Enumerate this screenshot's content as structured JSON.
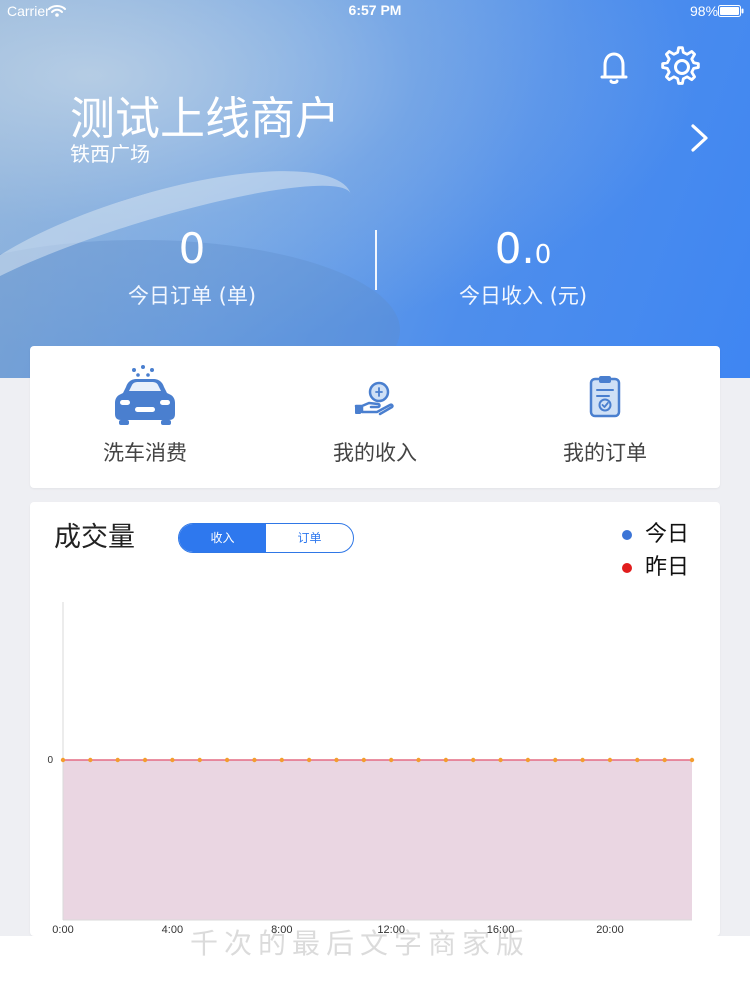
{
  "status_bar": {
    "carrier": "Carrier",
    "time": "6:57 PM",
    "battery": "98%"
  },
  "header": {
    "merchant_name": "测试上线商户",
    "merchant_location": "铁西广场",
    "icons": {
      "notification": "bell-icon",
      "settings": "gear-icon",
      "detail": "chevron-right-icon"
    },
    "stats": [
      {
        "value_main": "0",
        "value_decimal": "",
        "label": "今日订单 (单)"
      },
      {
        "value_main": "0.",
        "value_decimal": "0",
        "label": "今日收入 (元)"
      }
    ]
  },
  "quick_actions": [
    {
      "label": "洗车消费",
      "icon": "car-wash-icon"
    },
    {
      "label": "我的收入",
      "icon": "income-hand-icon"
    },
    {
      "label": "我的订单",
      "icon": "order-clipboard-icon"
    }
  ],
  "chart_card": {
    "title": "成交量",
    "tabs": [
      {
        "label": "收入",
        "active": true
      },
      {
        "label": "订单",
        "active": false
      }
    ],
    "legend": [
      {
        "label": "今日",
        "color": "#3b74d6"
      },
      {
        "label": "昨日",
        "color": "#e11d1d"
      }
    ]
  },
  "chart_data": {
    "type": "area",
    "x": [
      0,
      1,
      2,
      3,
      4,
      5,
      6,
      7,
      8,
      9,
      10,
      11,
      12,
      13,
      14,
      15,
      16,
      17,
      18,
      19,
      20,
      21,
      22,
      23
    ],
    "x_ticks": [
      {
        "value": 0,
        "label": "0:00"
      },
      {
        "value": 4,
        "label": "4:00"
      },
      {
        "value": 8,
        "label": "8:00"
      },
      {
        "value": 12,
        "label": "12:00"
      },
      {
        "value": 16,
        "label": "16:00"
      },
      {
        "value": 20,
        "label": "20:00"
      }
    ],
    "y_ticks": [
      {
        "value": 0,
        "label": "0"
      }
    ],
    "xlim": [
      0,
      23
    ],
    "series": [
      {
        "name": "今日",
        "values": [
          0,
          0,
          0,
          0,
          0,
          0,
          0,
          0,
          0,
          0,
          0,
          0,
          0,
          0,
          0,
          0,
          0,
          0,
          0,
          0,
          0,
          0,
          0,
          0
        ],
        "color": "#3b74d6"
      },
      {
        "name": "昨日",
        "values": [
          0,
          0,
          0,
          0,
          0,
          0,
          0,
          0,
          0,
          0,
          0,
          0,
          0,
          0,
          0,
          0,
          0,
          0,
          0,
          0,
          0,
          0,
          0,
          0
        ],
        "color": "#e11d1d"
      }
    ],
    "line_color": "#e46b84",
    "point_color": "#f39d2f",
    "fill_color": "#ead6e2",
    "legend_position": "top-right",
    "grid": false
  },
  "bottom_ghost_text": "千次的最后文字商家版"
}
